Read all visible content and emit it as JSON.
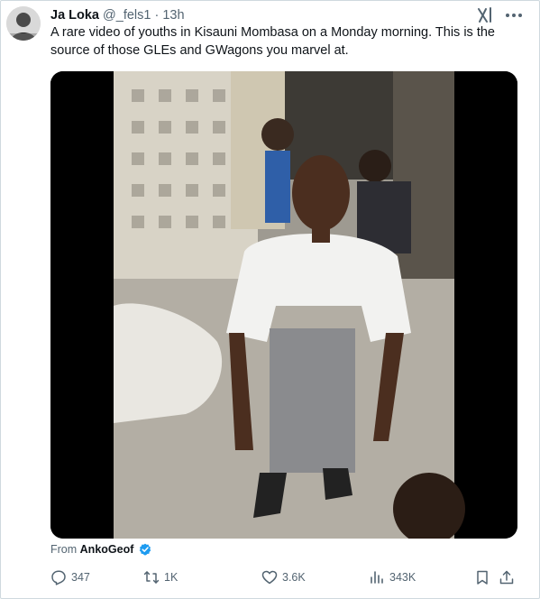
{
  "author": {
    "name": "Ja Loka",
    "handle": "@_fels1",
    "separator": "·",
    "time": "13h"
  },
  "tweet": {
    "text": "A rare video of youths in Kisauni Mombasa on a Monday morning. This is the source of those GLEs and GWagons you marvel at."
  },
  "media": {
    "type": "video"
  },
  "attribution": {
    "prefix": "From",
    "account": "AnkoGeof"
  },
  "actions": {
    "replies": "347",
    "reposts": "1K",
    "likes": "3.6K",
    "views": "343K"
  },
  "icons": {
    "grok": "grok-icon",
    "more": "more-icon",
    "verified": "verified-badge-icon",
    "reply": "reply-icon",
    "repost": "repost-icon",
    "like": "like-icon",
    "views": "views-icon",
    "bookmark": "bookmark-icon",
    "share": "share-icon"
  },
  "colors": {
    "text_primary": "#0f1419",
    "text_secondary": "#536471",
    "verified": "#1d9bf0",
    "border": "#cfd9de"
  }
}
